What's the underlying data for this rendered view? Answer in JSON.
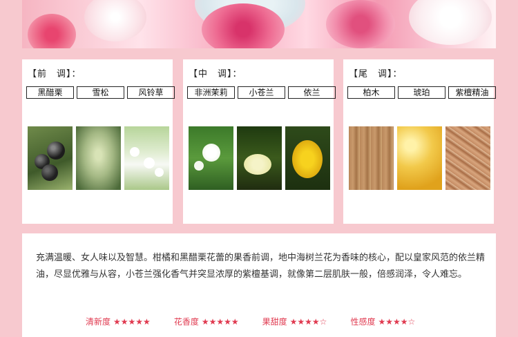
{
  "notes": [
    {
      "title": "【前　调】：",
      "tags": [
        "黑醋栗",
        "雪松",
        "风铃草"
      ],
      "images": [
        "blackcurrant-photo",
        "cedar-cone-photo",
        "bluebell-photo"
      ]
    },
    {
      "title": "【中　调】：",
      "tags": [
        "非洲茉莉",
        "小苍兰",
        "依兰"
      ],
      "images": [
        "african-jasmine-photo",
        "freesia-photo",
        "ylang-ylang-photo"
      ]
    },
    {
      "title": "【尾　调】：",
      "tags": [
        "柏木",
        "琥珀",
        "紫檀精油"
      ],
      "images": [
        "cypress-wood-photo",
        "amber-photo",
        "sandalwood-photo"
      ]
    }
  ],
  "description": "充满温暖、女人味以及智慧。柑橘和黑醋栗花蕾的果香前调，地中海树兰花为香味的核心，配以皇家风范的依兰精油，尽显优雅与从容，小苍兰强化香气并突显浓厚的紫檀基调，就像第二层肌肤一般，倍感润泽，令人难忘。",
  "ratings": [
    {
      "label": "清新度",
      "stars": "★★★★★"
    },
    {
      "label": "花香度",
      "stars": "★★★★★"
    },
    {
      "label": "果甜度",
      "stars": "★★★★☆"
    },
    {
      "label": "性感度",
      "stars": "★★★★☆"
    }
  ],
  "colors": {
    "background": "#f7c9cf",
    "accent": "#e03a50"
  }
}
